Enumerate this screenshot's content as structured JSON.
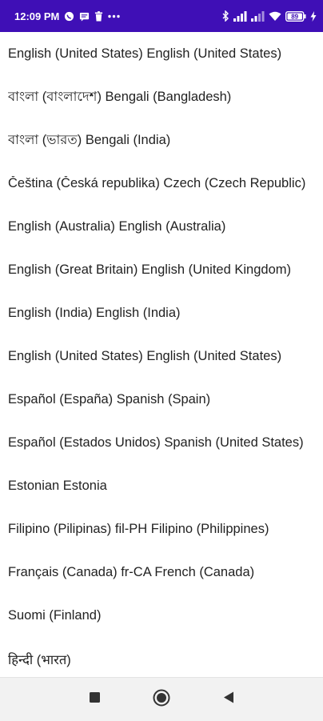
{
  "status_bar": {
    "time": "12:09 PM",
    "battery": "89"
  },
  "languages": [
    "English (United States) English (United States)",
    "বাংলা (বাংলাদেশ) Bengali (Bangladesh)",
    "বাংলা (ভারত) Bengali (India)",
    "Čeština (Česká republika) Czech (Czech Republic)",
    "English (Australia) English (Australia)",
    "English (Great Britain) English (United Kingdom)",
    "English (India) English (India)",
    "English (United States) English (United States)",
    "Español (España) Spanish (Spain)",
    "Español (Estados Unidos) Spanish (United States)",
    "Estonian Estonia",
    "Filipino (Pilipinas) fil-PH Filipino (Philippines)",
    "Français (Canada) fr-CA French (Canada)",
    "Suomi (Finland)",
    "हिन्दी (भारत)"
  ],
  "icons": {
    "status_left": [
      "whatsapp-icon",
      "message-icon",
      "trash-icon",
      "more-icon"
    ],
    "status_right": [
      "bluetooth-icon",
      "signal-icon",
      "signal-icon-2",
      "wifi-icon",
      "battery-icon",
      "charging-icon"
    ],
    "nav": [
      "recents-square-icon",
      "home-circle-icon",
      "back-triangle-icon"
    ]
  },
  "colors": {
    "status_bar_bg": "#3f0fb6",
    "text": "#222222",
    "nav_bar_bg": "#f2f2f2"
  }
}
